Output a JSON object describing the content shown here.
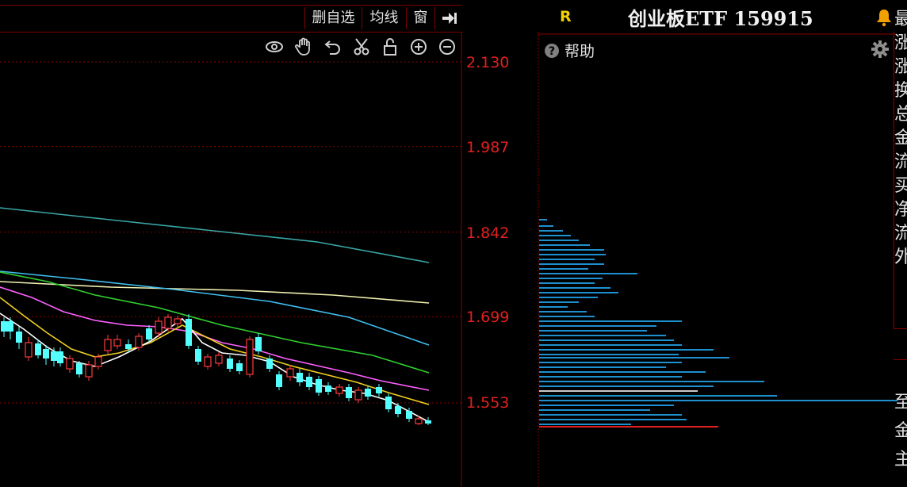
{
  "toolbar": {
    "delete_fav": "删自选",
    "ma_line": "均线",
    "window": "窗"
  },
  "icons": {
    "view": "eye-icon",
    "hand": "hand-icon",
    "undo": "undo-icon",
    "cut": "scissors-icon",
    "lock": "lock-icon",
    "zoom_in": "zoom-in-icon",
    "zoom_out": "zoom-out-icon",
    "expand": "arrow-right-bar-icon",
    "alert": "bell-icon",
    "help": "question-icon",
    "settings": "gear-icon"
  },
  "price_axis": [
    "2.130",
    "1.987",
    "1.842",
    "1.699",
    "1.553"
  ],
  "header": {
    "r_badge": "R",
    "security_name": "创业板ETF 159915"
  },
  "right_panel": {
    "help_label": "帮助"
  },
  "side_strip_top": [
    "最",
    "涨",
    "涨",
    "换",
    "总",
    "金",
    "流",
    "买",
    "净",
    "流",
    "外"
  ],
  "side_strip_bottom": [
    "至",
    "金",
    "主"
  ],
  "colors": {
    "background": "#000000",
    "axis_red": "#e02020",
    "grid_red": "#8a0000",
    "candle_up": "#ff3b3b",
    "candle_down": "#54ffff",
    "volume_bar": "#1e90d0",
    "ma_white": "#ffffff",
    "ma_yellow": "#f0d020",
    "ma_magenta": "#ff60ff",
    "ma_green": "#30d030",
    "ma_cyan": "#40c0f0",
    "ma_teal": "#3aa7a7",
    "ma_pale_yellow": "#f0f0b0",
    "title_yellow": "#f0d000"
  }
}
